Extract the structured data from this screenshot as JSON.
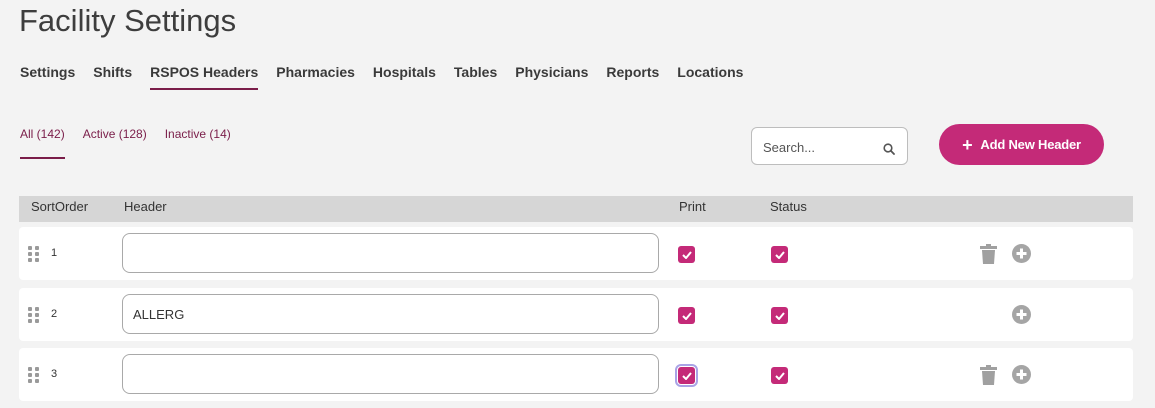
{
  "page": {
    "title": "Facility Settings"
  },
  "nav": {
    "tabs": [
      {
        "label": "Settings"
      },
      {
        "label": "Shifts"
      },
      {
        "label": "RSPOS Headers"
      },
      {
        "label": "Pharmacies"
      },
      {
        "label": "Hospitals"
      },
      {
        "label": "Tables"
      },
      {
        "label": "Physicians"
      },
      {
        "label": "Reports"
      },
      {
        "label": "Locations"
      }
    ],
    "active": "RSPOS Headers"
  },
  "filters": {
    "tabs": [
      {
        "label": "All (142)"
      },
      {
        "label": "Active (128)"
      },
      {
        "label": "Inactive (14)"
      }
    ],
    "active": "All (142)"
  },
  "search": {
    "placeholder": "Search...",
    "value": "",
    "icon": "search-icon"
  },
  "add_button": {
    "label": "Add New Header",
    "icon": "plus-icon"
  },
  "table": {
    "columns": {
      "sort": "SortOrder",
      "header": "Header",
      "print": "Print",
      "status": "Status"
    },
    "rows": [
      {
        "sort": "1",
        "header": "",
        "print": true,
        "status": true,
        "deletable": true
      },
      {
        "sort": "2",
        "header": "ALLERG",
        "print": true,
        "status": true,
        "deletable": false
      },
      {
        "sort": "3",
        "header": "",
        "print": true,
        "status": true,
        "deletable": true,
        "print_focused": true
      }
    ]
  },
  "colors": {
    "accent": "#c42a78",
    "nav_underline": "#7a1d49",
    "header_bg": "#d6d6d6"
  }
}
